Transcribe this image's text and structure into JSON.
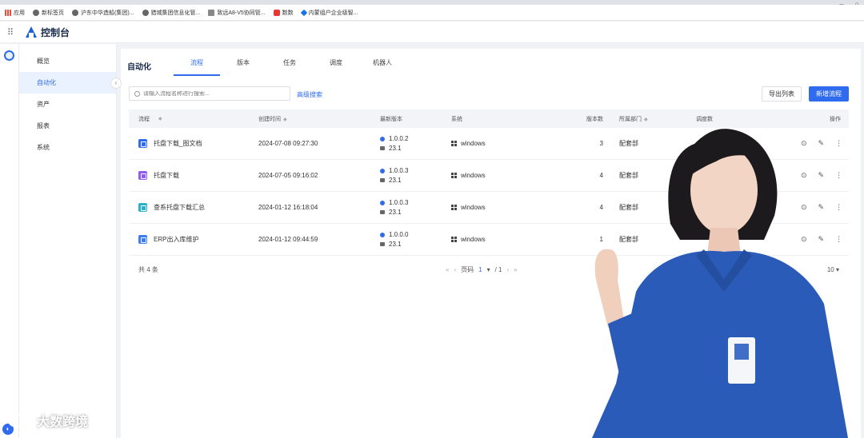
{
  "bookmarks": [
    "应用",
    "新标签页",
    "沪东中华造船(集团)...",
    "猎城集团信息化管...",
    "致远A8-V5协同管...",
    "数数",
    "内蒙组户企业级智..."
  ],
  "app": {
    "title": "控制台"
  },
  "sidenav": {
    "items": [
      "概览",
      "自动化",
      "资产",
      "报表",
      "系统"
    ],
    "active_index": 1
  },
  "tabs": {
    "title": "自动化",
    "items": [
      "流程",
      "版本",
      "任务",
      "调度",
      "机器人"
    ],
    "active_index": 0
  },
  "toolbar": {
    "search_placeholder": "请输入流程名称进行搜索...",
    "advanced_search": "高级搜索",
    "export_label": "导出列表",
    "new_label": "新增流程"
  },
  "table": {
    "headers": {
      "name": "流程",
      "created": "创建时间",
      "version": "最新版本",
      "system": "系统",
      "count": "版本数",
      "dept": "所属部门",
      "schedule": "调度数",
      "ops": "操作"
    },
    "rows": [
      {
        "name": "托盘下载_图文档",
        "icon_color": "#2f6bef",
        "created": "2024-07-08 09:27:30",
        "version": "1.0.0.2",
        "sub_version": "23.1",
        "system": "windows",
        "count": "3",
        "dept": "配套部"
      },
      {
        "name": "托盘下载",
        "icon_color": "#8e5cf0",
        "created": "2024-07-05 09:16:02",
        "version": "1.0.0.3",
        "sub_version": "23.1",
        "system": "windows",
        "count": "4",
        "dept": "配套部"
      },
      {
        "name": "查系托盘下载汇总",
        "icon_color": "#2ab3c8",
        "created": "2024-01-12 16:18:04",
        "version": "1.0.0.3",
        "sub_version": "23.1",
        "system": "windows",
        "count": "4",
        "dept": "配套部"
      },
      {
        "name": "ERP出入库维护",
        "icon_color": "#3d7cf0",
        "created": "2024-01-12 09:44:59",
        "version": "1.0.0.0",
        "sub_version": "23.1",
        "system": "windows",
        "count": "1",
        "dept": "配套部"
      }
    ]
  },
  "pager": {
    "total": "共 4 条",
    "page_label": "页码",
    "current": "1",
    "total_pages": "/ 1",
    "page_size": "10"
  },
  "watermark": "大数跨境"
}
